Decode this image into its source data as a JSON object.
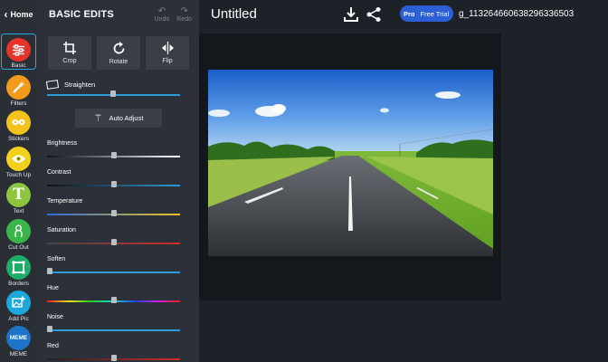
{
  "rail": {
    "home_label": "Home",
    "tools": [
      {
        "label": "Basic",
        "color": "#e8332a",
        "icon": "sliders-icon"
      },
      {
        "label": "Filters",
        "color": "#f29a1a",
        "icon": "magic-wand-icon"
      },
      {
        "label": "Stickers",
        "color": "#f3c21b",
        "icon": "sticker-icon"
      },
      {
        "label": "Touch Up",
        "color": "#f3d11b",
        "icon": "eye-icon"
      },
      {
        "label": "Text",
        "color": "#8cc63f",
        "icon": "text-icon"
      },
      {
        "label": "Cut Out",
        "color": "#3ab54a",
        "icon": "scissors-icon"
      },
      {
        "label": "Borders",
        "color": "#1fae6a",
        "icon": "frame-icon"
      },
      {
        "label": "Add Pic",
        "color": "#1ca7dd",
        "icon": "add-picture-icon"
      },
      {
        "label": "MEME",
        "color": "#1e74c8",
        "icon": "meme-icon"
      }
    ]
  },
  "panel": {
    "title": "BASIC EDITS",
    "undo_label": "Undo",
    "redo_label": "Redo",
    "top_tools": [
      {
        "label": "Crop",
        "icon": "crop-icon"
      },
      {
        "label": "Rotate",
        "icon": "rotate-icon"
      },
      {
        "label": "Flip",
        "icon": "flip-icon"
      }
    ],
    "straighten_label": "Straighten",
    "auto_adjust_label": "Auto Adjust",
    "sliders": [
      {
        "label": "Brightness",
        "value": 0.5
      },
      {
        "label": "Contrast",
        "value": 0.5
      },
      {
        "label": "Temperature",
        "value": 0.5
      },
      {
        "label": "Saturation",
        "value": 0.5
      },
      {
        "label": "Soften",
        "value": 0.0
      },
      {
        "label": "Hue",
        "value": 0.5
      },
      {
        "label": "Noise",
        "value": 0.0
      },
      {
        "label": "Red",
        "value": 0.5
      }
    ]
  },
  "topbar": {
    "doc_title": "Untitled",
    "pro_label": "Pro",
    "free_trial_label": "Free Trial",
    "filename": "g_113264660638296336503"
  },
  "colors": {
    "accent": "#2aa7e8",
    "pro_pill": "#2c5ed6"
  }
}
